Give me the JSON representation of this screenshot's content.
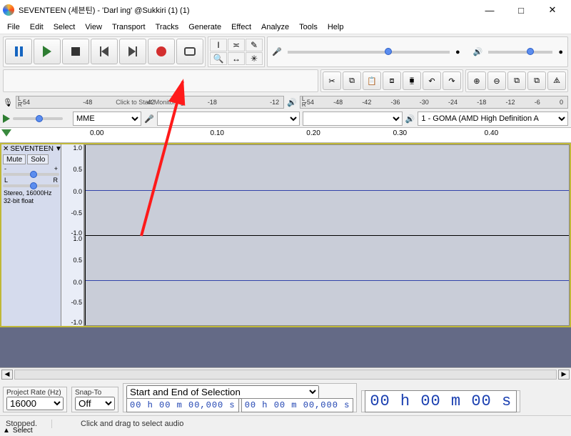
{
  "window": {
    "title": "SEVENTEEN (세븐틴) - 'Darl ing' @Sukkiri (1) (1)",
    "min": "—",
    "max": "□",
    "close": "✕"
  },
  "menu": [
    "File",
    "Edit",
    "Select",
    "View",
    "Transport",
    "Tracks",
    "Generate",
    "Effect",
    "Analyze",
    "Tools",
    "Help"
  ],
  "meters": {
    "rec_ticks": [
      "-54",
      "-48",
      "-42",
      "",
      "-18",
      "-12"
    ],
    "rec_hint": "Click to Start Monitoring",
    "play_ticks": [
      "-54",
      "-48",
      "-42",
      "-36",
      "-30",
      "-24",
      "-18",
      "-12",
      "-6",
      "0"
    ]
  },
  "device": {
    "host": "MME",
    "output": "1 - GOMA (AMD High Definition A"
  },
  "timeline": {
    "ticks": [
      {
        "pos": 0,
        "label": "0.00"
      },
      {
        "pos": 25,
        "label": "0.10"
      },
      {
        "pos": 50,
        "label": "0.20"
      },
      {
        "pos": 65,
        "label": "0.30"
      },
      {
        "pos": 85,
        "label": "0.40"
      }
    ]
  },
  "track": {
    "name": "SEVENTEEN",
    "mute": "Mute",
    "solo": "Solo",
    "L": "L",
    "R": "R",
    "plus": "+",
    "minus": "-",
    "format_line1": "Stereo, 16000Hz",
    "format_line2": "32-bit float",
    "select": "Select",
    "scale": [
      "1.0",
      "0.5",
      "0.0",
      "-0.5",
      "-1.0",
      "1.0",
      "0.5",
      "0.0",
      "-0.5",
      "-1.0"
    ]
  },
  "bottom": {
    "project_rate_label": "Project Rate (Hz)",
    "project_rate": "16000",
    "snap_label": "Snap-To",
    "snap_value": "Off",
    "selection_label": "Start and End of Selection",
    "sel_start": "00 h 00 m 00,000 s",
    "sel_end": "00 h 00 m 00,000 s",
    "big_time": "00 h 00 m 00 s"
  },
  "status": {
    "state": "Stopped.",
    "hint": "Click and drag to select audio"
  },
  "tool_icons": {
    "ibeam": "I",
    "envelope": "≍",
    "draw": "✎",
    "zoom": "🔍",
    "timeshift": "↔",
    "multi": "✳",
    "cut": "✂",
    "copy": "⧉",
    "paste": "📋",
    "trim": "⧈",
    "silence": "⧯",
    "undo": "↶",
    "redo": "↷",
    "zin": "⊕",
    "zout": "⊖",
    "zfit": "⧉",
    "ztog": "⧌"
  }
}
